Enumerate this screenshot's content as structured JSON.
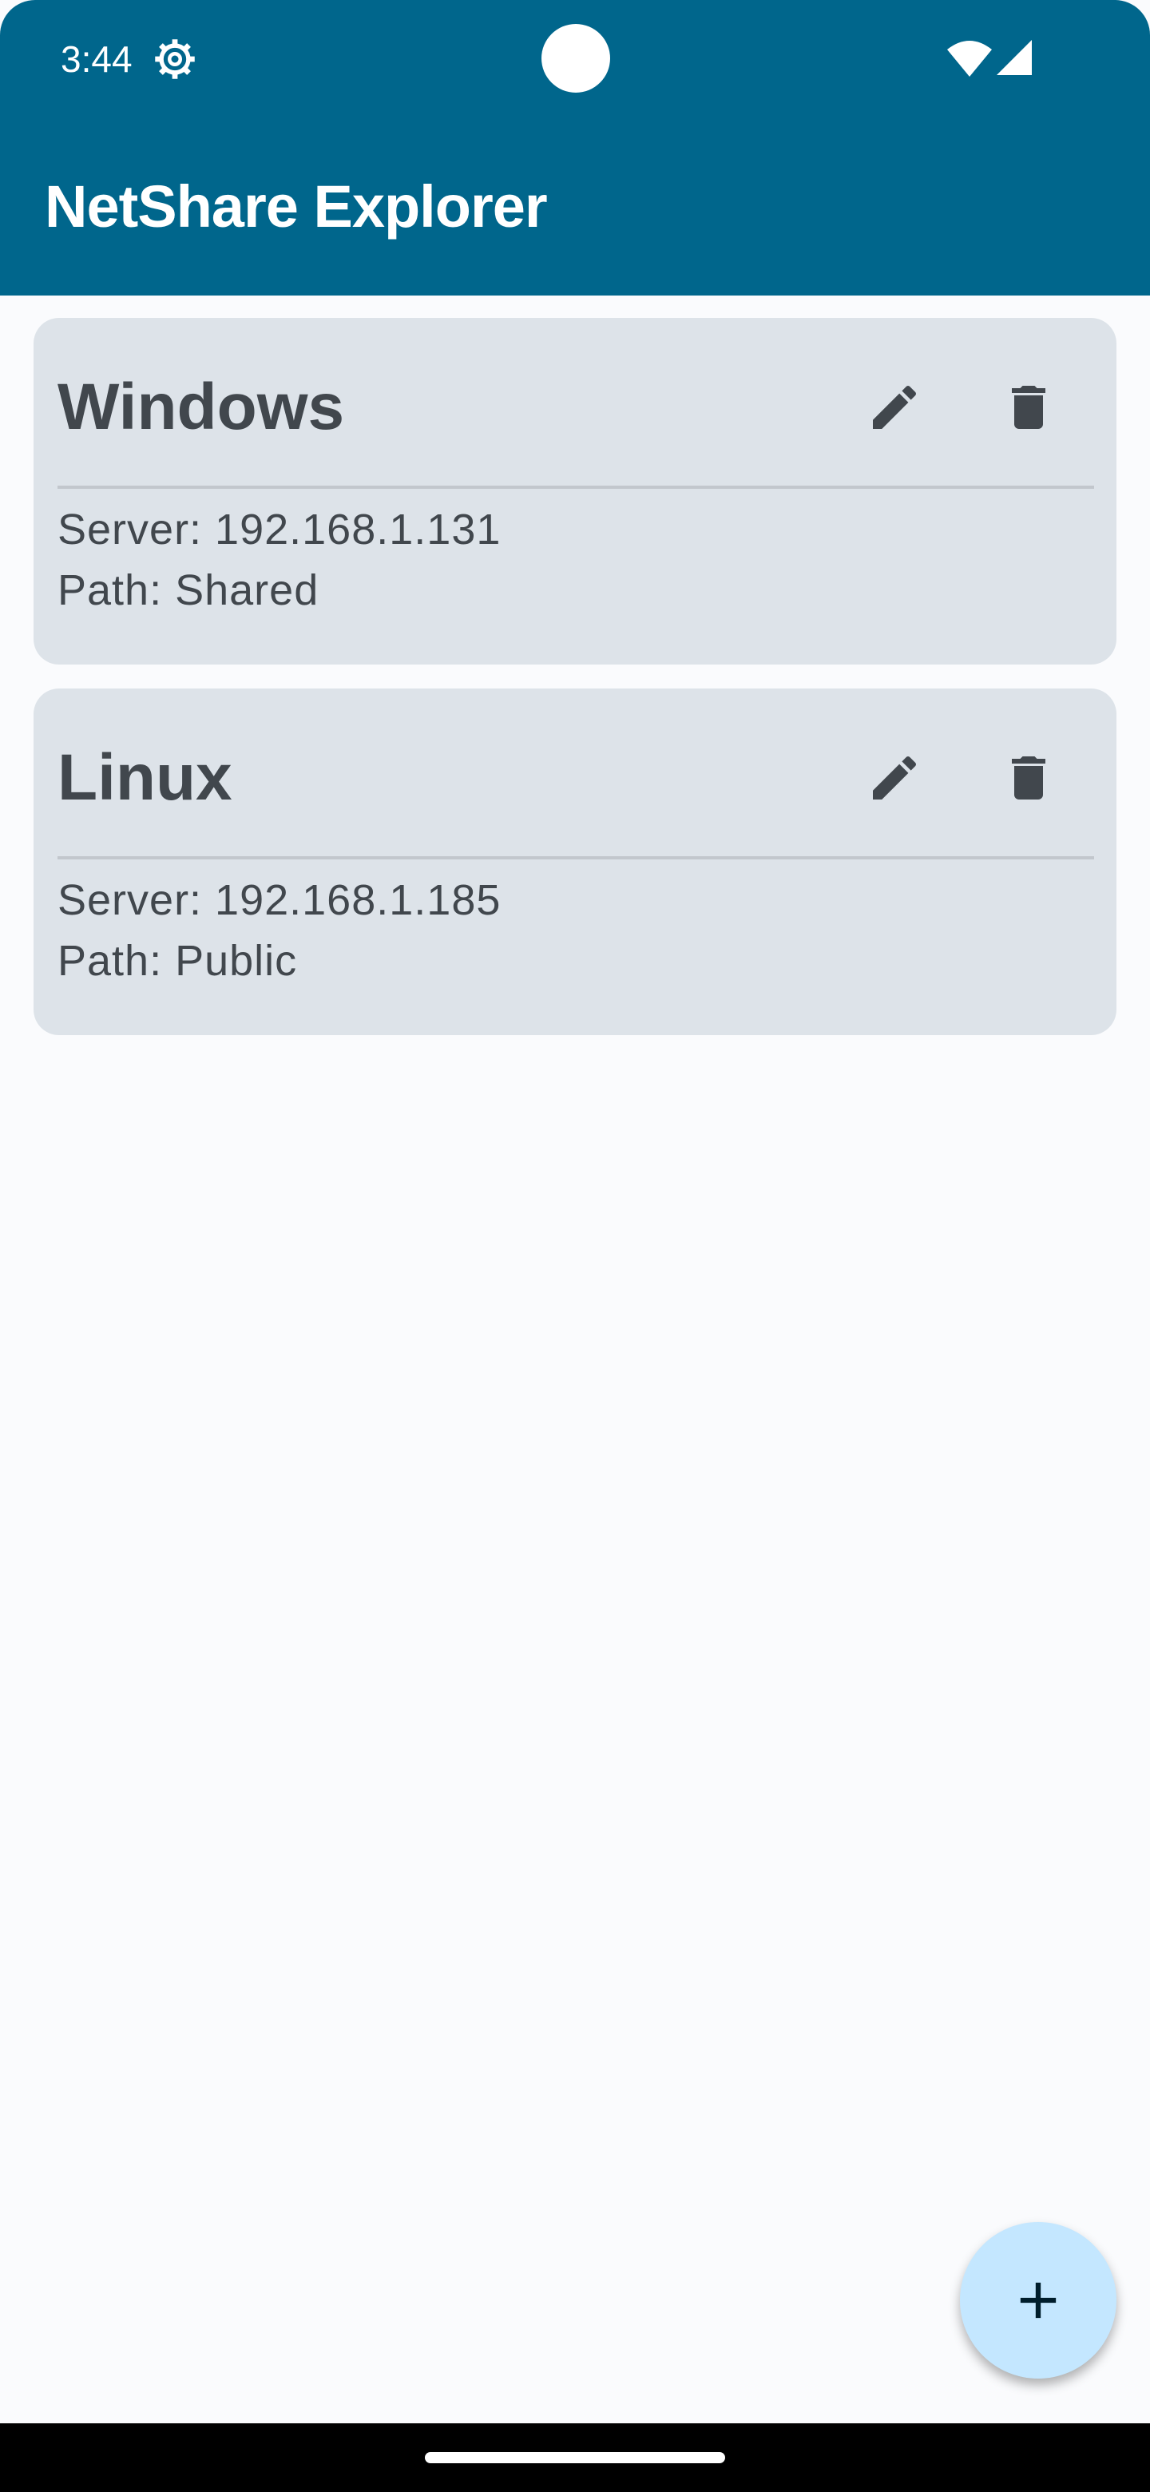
{
  "status_bar": {
    "time": "3:44",
    "icons": [
      "gear-icon",
      "wifi-icon",
      "cellular-signal-icon"
    ]
  },
  "app_bar": {
    "title": "NetShare Explorer",
    "color": "#00668c"
  },
  "shares": [
    {
      "name": "Windows",
      "server": "Server: 192.168.1.131",
      "path": "Path: Shared",
      "actions": [
        "edit-icon",
        "delete-icon"
      ]
    },
    {
      "name": "Linux",
      "server": "Server: 192.168.1.185",
      "path": "Path: Public",
      "actions": [
        "edit-icon",
        "delete-icon"
      ]
    }
  ],
  "fab": {
    "icon": "plus-icon",
    "color": "#c4e7ff"
  },
  "colors": {
    "card_background": "#dde3e9",
    "text": "#41474d",
    "page_background": "#fafbfd"
  }
}
